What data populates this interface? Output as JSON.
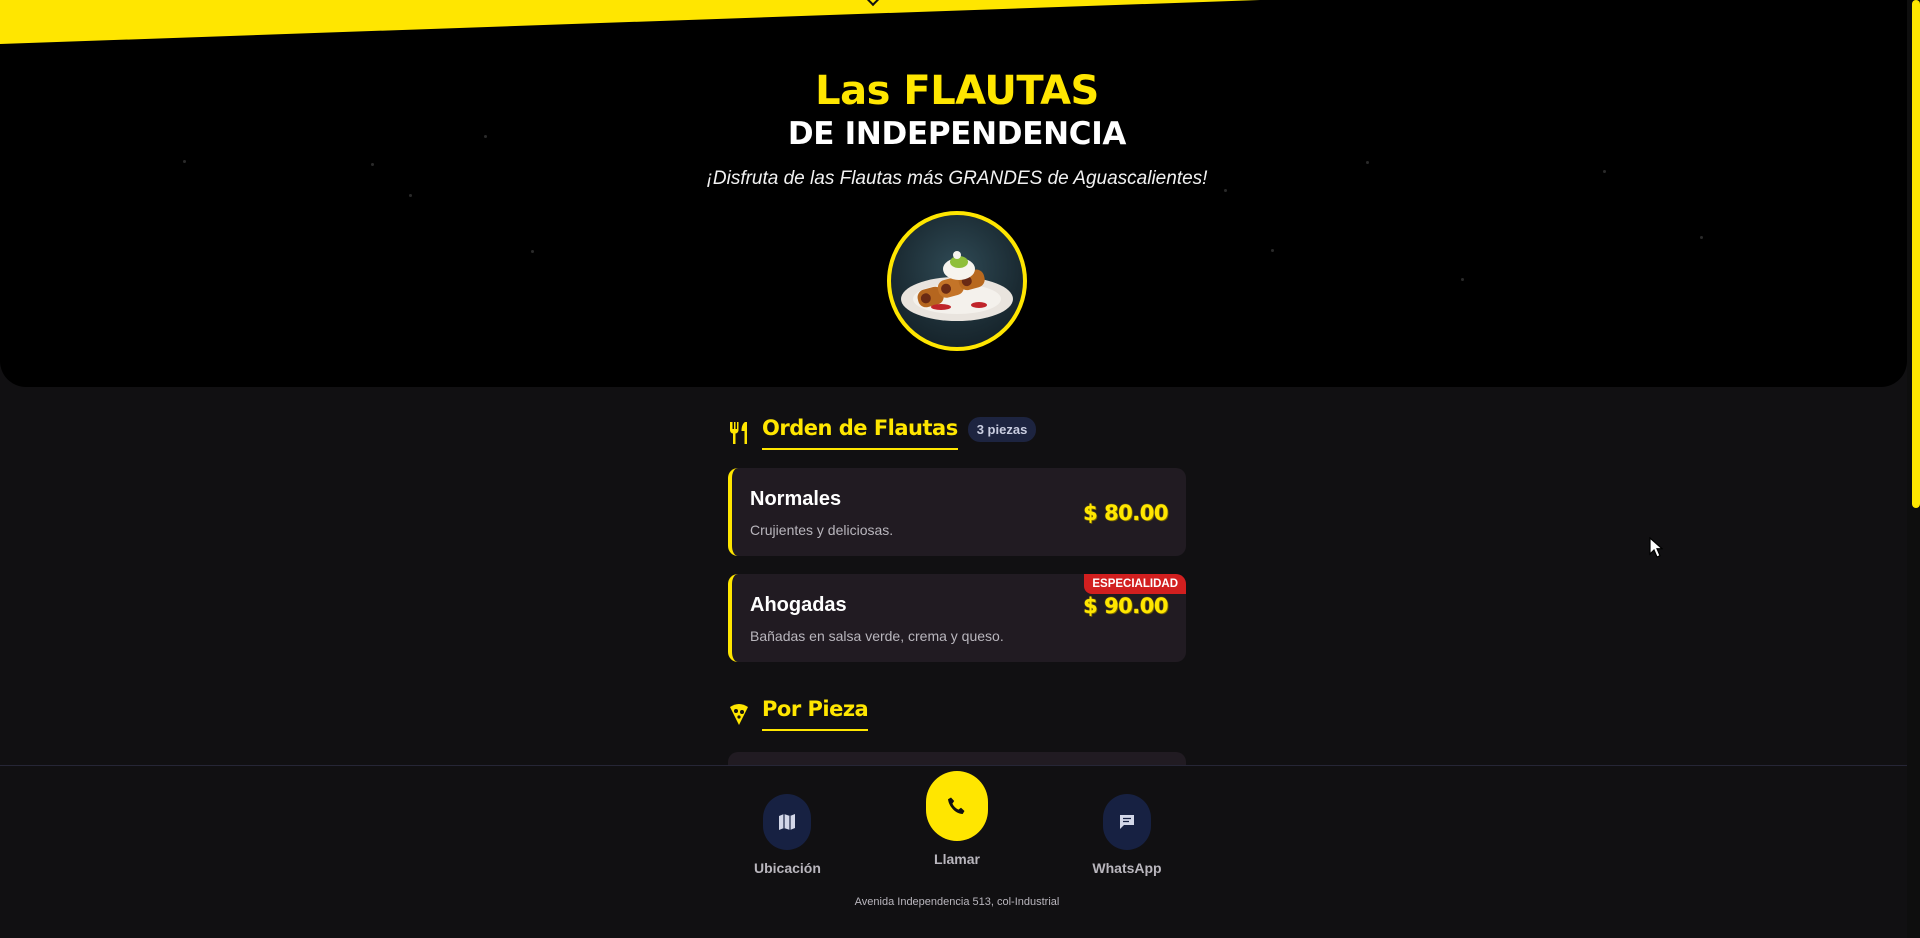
{
  "hero": {
    "title_line1": "Las FLAUTAS",
    "title_line2": "DE INDEPENDENCIA",
    "subtitle": "¡Disfruta de las Flautas más GRANDES de Aguascalientes!"
  },
  "sections": {
    "orden": {
      "title": "Orden de Flautas",
      "badge": "3 piezas",
      "icon": "utensils-icon",
      "items": [
        {
          "name": "Normales",
          "description": "Crujientes y deliciosas.",
          "price": "$ 80.00"
        },
        {
          "name": "Ahogadas",
          "description": "Bañadas en salsa verde, crema y queso.",
          "price": "$ 90.00",
          "tag": "ESPECIALIDAD"
        }
      ]
    },
    "pieza": {
      "title": "Por Pieza",
      "icon": "pizza-slice-icon"
    }
  },
  "bottom_nav": {
    "location": {
      "label": "Ubicación",
      "icon": "map-icon"
    },
    "call": {
      "label": "Llamar",
      "icon": "phone-icon"
    },
    "whatsapp": {
      "label": "WhatsApp",
      "icon": "message-icon"
    }
  },
  "footer": {
    "address": "Avenida Independencia 513, col-Industrial"
  },
  "colors": {
    "accent": "#ffe600",
    "background": "#111012",
    "card": "#211b22",
    "tag": "#d21f1f"
  }
}
